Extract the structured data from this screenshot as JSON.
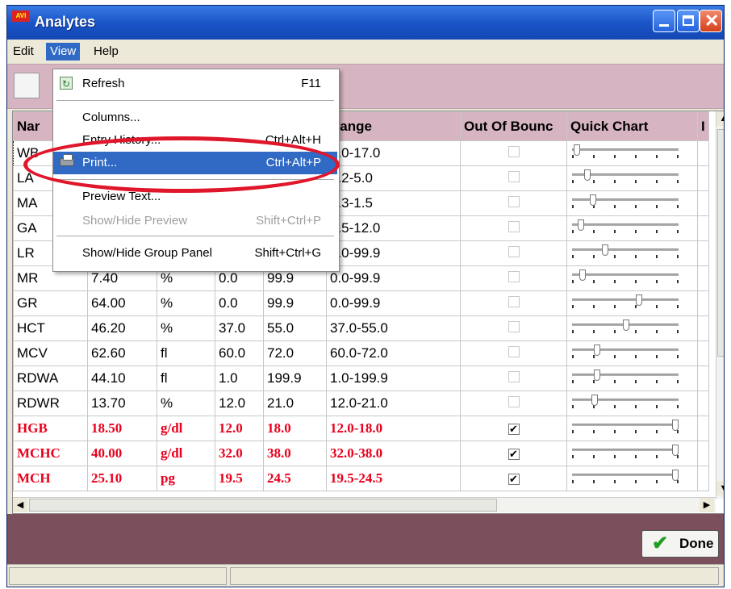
{
  "window": {
    "title": "Analytes",
    "logo_text": "AVI"
  },
  "menu": {
    "edit": "Edit",
    "view": "View",
    "help": "Help"
  },
  "view_menu": {
    "refresh": {
      "label": "Refresh",
      "shortcut": "F11"
    },
    "columns": {
      "label": "Columns..."
    },
    "entry_history": {
      "label": "Entry History...",
      "shortcut": "Ctrl+Alt+H"
    },
    "print": {
      "label": "Print...",
      "shortcut": "Ctrl+Alt+P"
    },
    "preview_text": {
      "label": "Preview Text..."
    },
    "show_hide_preview": {
      "label": "Show/Hide Preview",
      "shortcut": "Shift+Ctrl+P"
    },
    "show_hide_group_panel": {
      "label": "Show/Hide Group Panel",
      "shortcut": "Shift+Ctrl+G"
    }
  },
  "grid": {
    "headers": [
      "Nar",
      "",
      "",
      "",
      "",
      "Range",
      "Out Of Bounc",
      "Quick Chart",
      "I"
    ],
    "rows": [
      {
        "name": "WB",
        "value": "",
        "unit": "",
        "low": "",
        "high": "",
        "range": "6.0-17.0",
        "oob": false,
        "chart": 0.02,
        "selected": true
      },
      {
        "name": "LA",
        "value": "",
        "unit": "",
        "low": "",
        "high": "",
        "range": "1.2-5.0",
        "oob": false,
        "chart": 0.12
      },
      {
        "name": "MA",
        "value": "",
        "unit": "",
        "low": "",
        "high": "",
        "range": "0.3-1.5",
        "oob": false,
        "chart": 0.18
      },
      {
        "name": "GA",
        "value": "",
        "unit": "",
        "low": "",
        "high": "",
        "range": "3.5-12.0",
        "oob": false,
        "chart": 0.06
      },
      {
        "name": "LR",
        "value": "",
        "unit": "",
        "low": "",
        "high": "",
        "range": "0.0-99.9",
        "oob": false,
        "chart": 0.3
      },
      {
        "name": "MR",
        "value": "7.40",
        "unit": "%",
        "low": "0.0",
        "high": "99.9",
        "range": "0.0-99.9",
        "oob": false,
        "chart": 0.07
      },
      {
        "name": "GR",
        "value": "64.00",
        "unit": "%",
        "low": "0.0",
        "high": "99.9",
        "range": "0.0-99.9",
        "oob": false,
        "chart": 0.64
      },
      {
        "name": "HCT",
        "value": "46.20",
        "unit": "%",
        "low": "37.0",
        "high": "55.0",
        "range": "37.0-55.0",
        "oob": false,
        "chart": 0.51
      },
      {
        "name": "MCV",
        "value": "62.60",
        "unit": "fl",
        "low": "60.0",
        "high": "72.0",
        "range": "60.0-72.0",
        "oob": false,
        "chart": 0.22
      },
      {
        "name": "RDWA",
        "value": "44.10",
        "unit": "fl",
        "low": "1.0",
        "high": "199.9",
        "range": "1.0-199.9",
        "oob": false,
        "chart": 0.22
      },
      {
        "name": "RDWR",
        "value": "13.70",
        "unit": "%",
        "low": "12.0",
        "high": "21.0",
        "range": "12.0-21.0",
        "oob": false,
        "chart": 0.19
      },
      {
        "name": "HGB",
        "value": "18.50",
        "unit": "g/dl",
        "low": "12.0",
        "high": "18.0",
        "range": "12.0-18.0",
        "oob": true,
        "chart": 1.0
      },
      {
        "name": "MCHC",
        "value": "40.00",
        "unit": "g/dl",
        "low": "32.0",
        "high": "38.0",
        "range": "32.0-38.0",
        "oob": true,
        "chart": 1.0
      },
      {
        "name": "MCH",
        "value": "25.10",
        "unit": "pg",
        "low": "19.5",
        "high": "24.5",
        "range": "19.5-24.5",
        "oob": true,
        "chart": 1.0
      }
    ]
  },
  "check_mark": "✔",
  "done_button": {
    "label": "Done",
    "icon": "check-icon"
  }
}
